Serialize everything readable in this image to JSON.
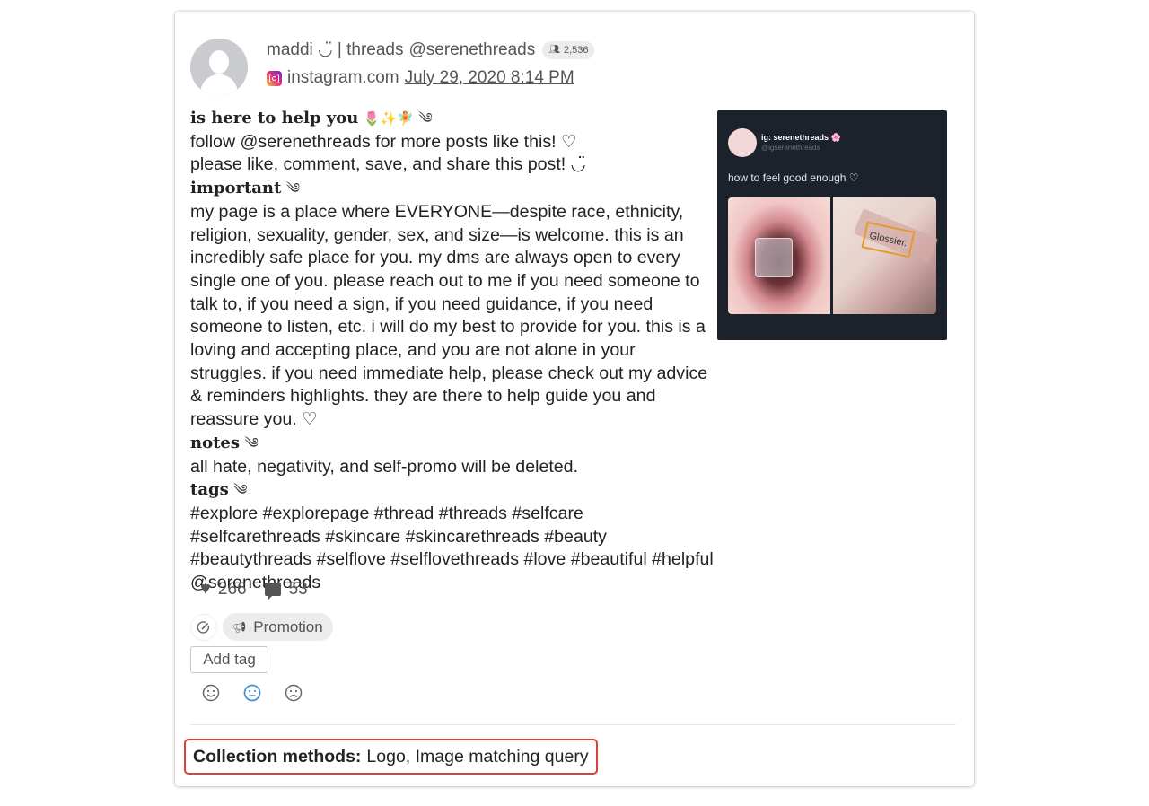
{
  "post": {
    "author_name": "maddi ◡̈ | threads",
    "author_handle": "@serenethreads",
    "followers": "2,536",
    "source": "instagram.com",
    "date": "July 29, 2020 8:14 PM",
    "icons": {
      "avatar": "default-user-avatar",
      "followers": "people-icon",
      "source": "instagram-icon"
    }
  },
  "body": {
    "heading1": "is here to help you",
    "heading1_emoji": "🌷✨🧚",
    "swirl": "༄",
    "line_follow": "follow @serenethreads for more posts like this! ♡",
    "line_please": "please like, comment, save, and share this post! ◡̈",
    "heading2": "important",
    "paragraph_important": "my page is a place where EVERYONE—despite race, ethnicity, religion, sexuality, gender, sex, and size—is welcome. this is an incredibly safe place for you. my dms are always open to every single one of you. please reach out to me if you need someone to talk to, if you need a sign, if you need guidance, if you need someone to listen, etc. i will do my best to provide for you. this is a loving and accepting place, and you are not alone in your struggles. if you need immediate help, please check out my advice & reminders highlights. they are there to help guide you and reassure you. ♡",
    "heading3": "notes",
    "paragraph_notes": "all hate, negativity, and self-promo will be deleted.",
    "heading4": "tags",
    "paragraph_tags": "#explore #explorepage #thread #threads #selfcare #selfcarethreads #skincare #skincarethreads #beauty #beautythreads #selflove #selflovethreads #love #beautiful #helpful",
    "signature": "@serenethreads"
  },
  "thumbnail": {
    "name": "ig: serenethreads 🌸",
    "handle": "@igserenethreads",
    "caption": "how to feel good enough ♡",
    "logo_text": "Glossier.",
    "logo_box_color": "#e59a2c"
  },
  "stats": {
    "likes": "266",
    "comments": "53",
    "icons": {
      "likes": "heart-icon",
      "comments": "comment-icon"
    }
  },
  "tags": {
    "edit_icon": "edit-tag-icon",
    "chips": [
      {
        "label": "Promotion",
        "icon": "megaphone-icon"
      }
    ],
    "add_tag_label": "Add tag"
  },
  "sentiment": {
    "options": [
      "positive",
      "neutral",
      "negative"
    ],
    "selected": "neutral",
    "selected_color": "#4a90d9"
  },
  "collection": {
    "label": "Collection methods:",
    "value": "Logo, Image matching query",
    "highlight_color": "#d9403a"
  }
}
